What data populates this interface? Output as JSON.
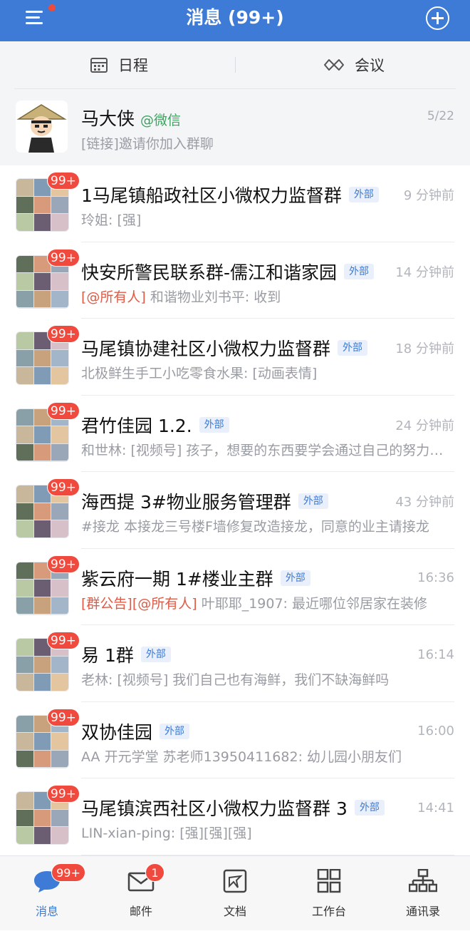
{
  "header": {
    "title": "消息 (99+)",
    "menu_icon": "menu-icon",
    "add_icon": "plus-circle-icon",
    "accent": "#3d7bd6"
  },
  "quick_actions": {
    "schedule_label": "日程",
    "meeting_label": "会议"
  },
  "pinned": {
    "name": "马大侠",
    "tag": "@微信",
    "time": "5/22",
    "preview": "[链接]邀请你加入群聊"
  },
  "chats": [
    {
      "title": "1马尾镇船政社区小微权力监督群",
      "tag": "外部",
      "time": "9 分钟前",
      "mention": "",
      "preview": "玲姐: [强]",
      "unread": "99+"
    },
    {
      "title": "快安所警民联系群-儒江和谐家园",
      "tag": "外部",
      "time": "14 分钟前",
      "mention": "[@所有人]",
      "preview": " 和谐物业刘书平: 收到",
      "unread": "99+"
    },
    {
      "title": "马尾镇协建社区小微权力监督群",
      "tag": "外部",
      "time": "18 分钟前",
      "mention": "",
      "preview": "北极鲜生手工小吃零食水果: [动画表情]",
      "unread": "99+"
    },
    {
      "title": "君竹佳园 1.2.",
      "tag": "外部",
      "time": "24 分钟前",
      "mention": "",
      "preview": "和世林: [视频号] 孩子，想要的东西要学会通过自己的努力去争取",
      "unread": "99+"
    },
    {
      "title": "海西提 3#物业服务管理群",
      "tag": "外部",
      "time": "43 分钟前",
      "mention": "",
      "preview": "#接龙 本接龙三号楼F墙修复改造接龙，同意的业主请接龙",
      "unread": "99+"
    },
    {
      "title": "紫云府一期 1#楼业主群",
      "tag": "外部",
      "time": "16:36",
      "mention": "[群公告][@所有人]",
      "preview": " 叶耶耶_1907: 最近哪位邻居家在装修",
      "unread": "99+"
    },
    {
      "title": "易 1群",
      "tag": "外部",
      "time": "16:14",
      "mention": "",
      "preview": "老林: [视频号] 我们自己也有海鲜，我们不缺海鲜吗",
      "unread": "99+"
    },
    {
      "title": "双协佳园",
      "tag": "外部",
      "time": "16:00",
      "mention": "",
      "preview": "AA 开元学堂 苏老师13950411682: 幼儿园小朋友们",
      "unread": "99+"
    },
    {
      "title": "马尾镇滨西社区小微权力监督群 3",
      "tag": "外部",
      "time": "14:41",
      "mention": "",
      "preview": "LIN-xian-ping: [强][强][强]",
      "unread": "99+"
    }
  ],
  "tabbar": {
    "items": [
      {
        "label": "消息",
        "icon": "chat-bubble-icon",
        "badge": "99+"
      },
      {
        "label": "邮件",
        "icon": "envelope-icon",
        "badge": "1"
      },
      {
        "label": "文档",
        "icon": "document-icon",
        "badge": ""
      },
      {
        "label": "工作台",
        "icon": "grid-icon",
        "badge": ""
      },
      {
        "label": "通讯录",
        "icon": "org-chart-icon",
        "badge": ""
      }
    ]
  }
}
